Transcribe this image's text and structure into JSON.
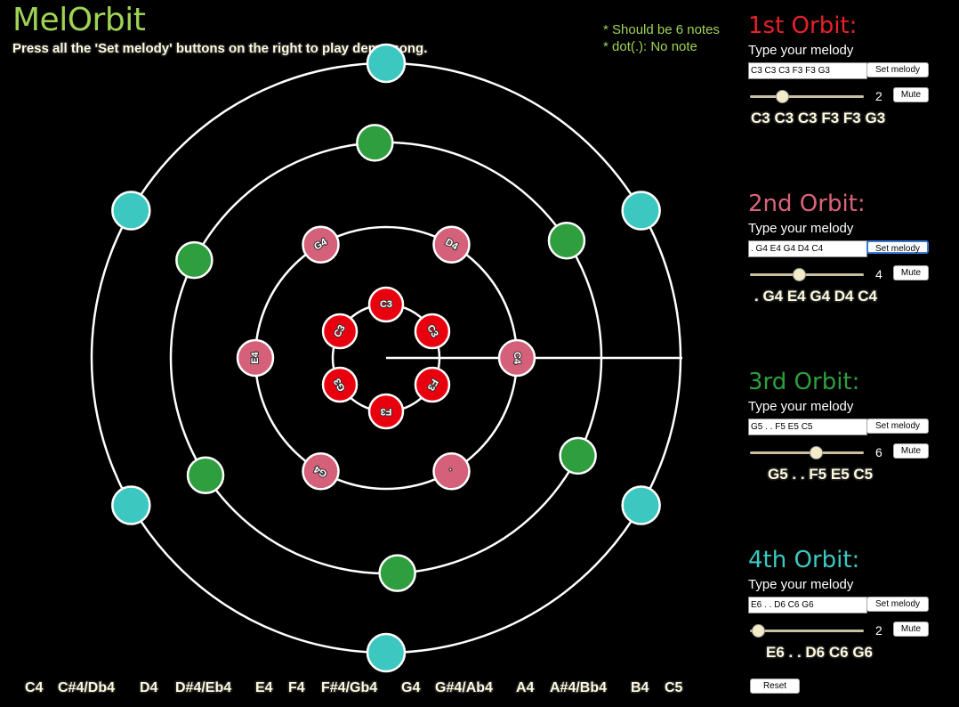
{
  "app": {
    "title": "MelOrbit",
    "subtitle": "Press all the 'Set melody' buttons on the right to play demo song.",
    "hint_line1": "* Should be 6 notes",
    "hint_line2": "* dot(.): No note"
  },
  "orbits": [
    {
      "heading": "1st Orbit:",
      "color": "#e8202a",
      "prompt": "Type your melody",
      "input_value": "C3 C3 C3 F3 F3 G3",
      "set_label": "Set melody",
      "speed": 2,
      "speed_fraction": 0.25,
      "mute_label": "Mute",
      "melody_display": "C3 C3 C3 F3 F3 G3",
      "planet_fill": "#e8000e",
      "planet_labels": [
        "C3",
        "C3",
        "F3",
        "F3",
        "G3",
        "C3"
      ]
    },
    {
      "heading": "2nd Orbit:",
      "color": "#d8647a",
      "prompt": "Type your melody",
      "input_value": ". G4 E4 G4 D4 C4",
      "set_label": "Set melody",
      "speed": 4,
      "speed_fraction": 0.42,
      "mute_label": "Mute",
      "melody_display": ". G4 E4 G4 D4 C4",
      "planet_fill": "#d4607a",
      "planet_labels": [
        "C4",
        "D4",
        "G4",
        "E4",
        "G4",
        "."
      ]
    },
    {
      "heading": "3rd Orbit:",
      "color": "#2e9e3e",
      "prompt": "Type your melody",
      "input_value": "G5 . . F5 E5 C5",
      "set_label": "Set melody",
      "speed": 6,
      "speed_fraction": 0.58,
      "mute_label": "Mute",
      "melody_display": "G5 . . F5 E5 C5",
      "planet_fill": "#2e9e3e",
      "planet_labels": [
        "",
        "",
        "",
        "",
        "",
        ""
      ]
    },
    {
      "heading": "4th Orbit:",
      "color": "#3cc8c0",
      "prompt": "Type your melody",
      "input_value": "E6 . . D6 C6 G6",
      "set_label": "Set melody",
      "speed": 2,
      "speed_fraction": 0.02,
      "mute_label": "Mute",
      "melody_display": "E6 . . D6 C6 G6",
      "planet_fill": "#3cc8c0",
      "planet_labels": [
        "",
        "",
        "",
        "",
        "",
        ""
      ]
    }
  ],
  "note_scale": [
    "C4",
    "C#4/Db4",
    "D4",
    "D#4/Eb4",
    "E4",
    "F4",
    "F#4/Gb4",
    "G4",
    "G#4/Ab4",
    "A4",
    "A#4/Bb4",
    "B4",
    "C5"
  ],
  "reset_label": "Reset"
}
